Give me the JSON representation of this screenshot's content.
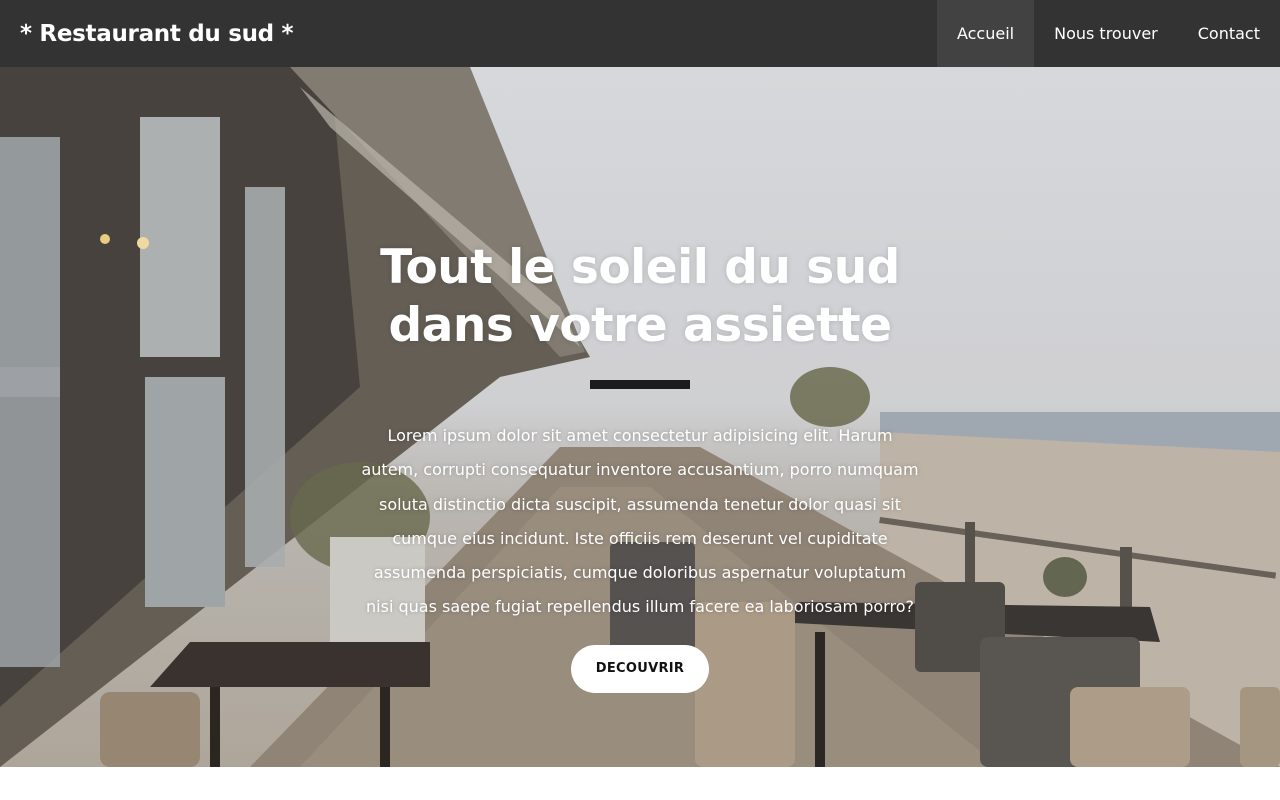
{
  "navbar": {
    "brand": "* Restaurant du sud *",
    "items": [
      {
        "label": "Accueil",
        "active": true
      },
      {
        "label": "Nous trouver",
        "active": false
      },
      {
        "label": "Contact",
        "active": false
      }
    ]
  },
  "hero": {
    "title_line1": "Tout le soleil du sud",
    "title_line2": "dans votre assiette",
    "text": "Lorem ipsum dolor sit amet consectetur adipisicing elit. Harum autem, corrupti consequatur inventore accusantium, porro numquam soluta distinctio dicta suscipit, assumenda tenetur dolor quasi sit cumque eius incidunt. Iste officiis rem deserunt vel cupiditate assumenda perspiciatis, cumque doloribus aspernatur voluptatum nisi quas saepe fugiat repellendus illum facere ea laboriosam porro?",
    "button_label": "DECOUVRIR"
  },
  "colors": {
    "navbar_bg": "#333333",
    "nav_active_bg": "#424242",
    "divider": "#1c1c1c",
    "button_bg": "#ffffff"
  }
}
